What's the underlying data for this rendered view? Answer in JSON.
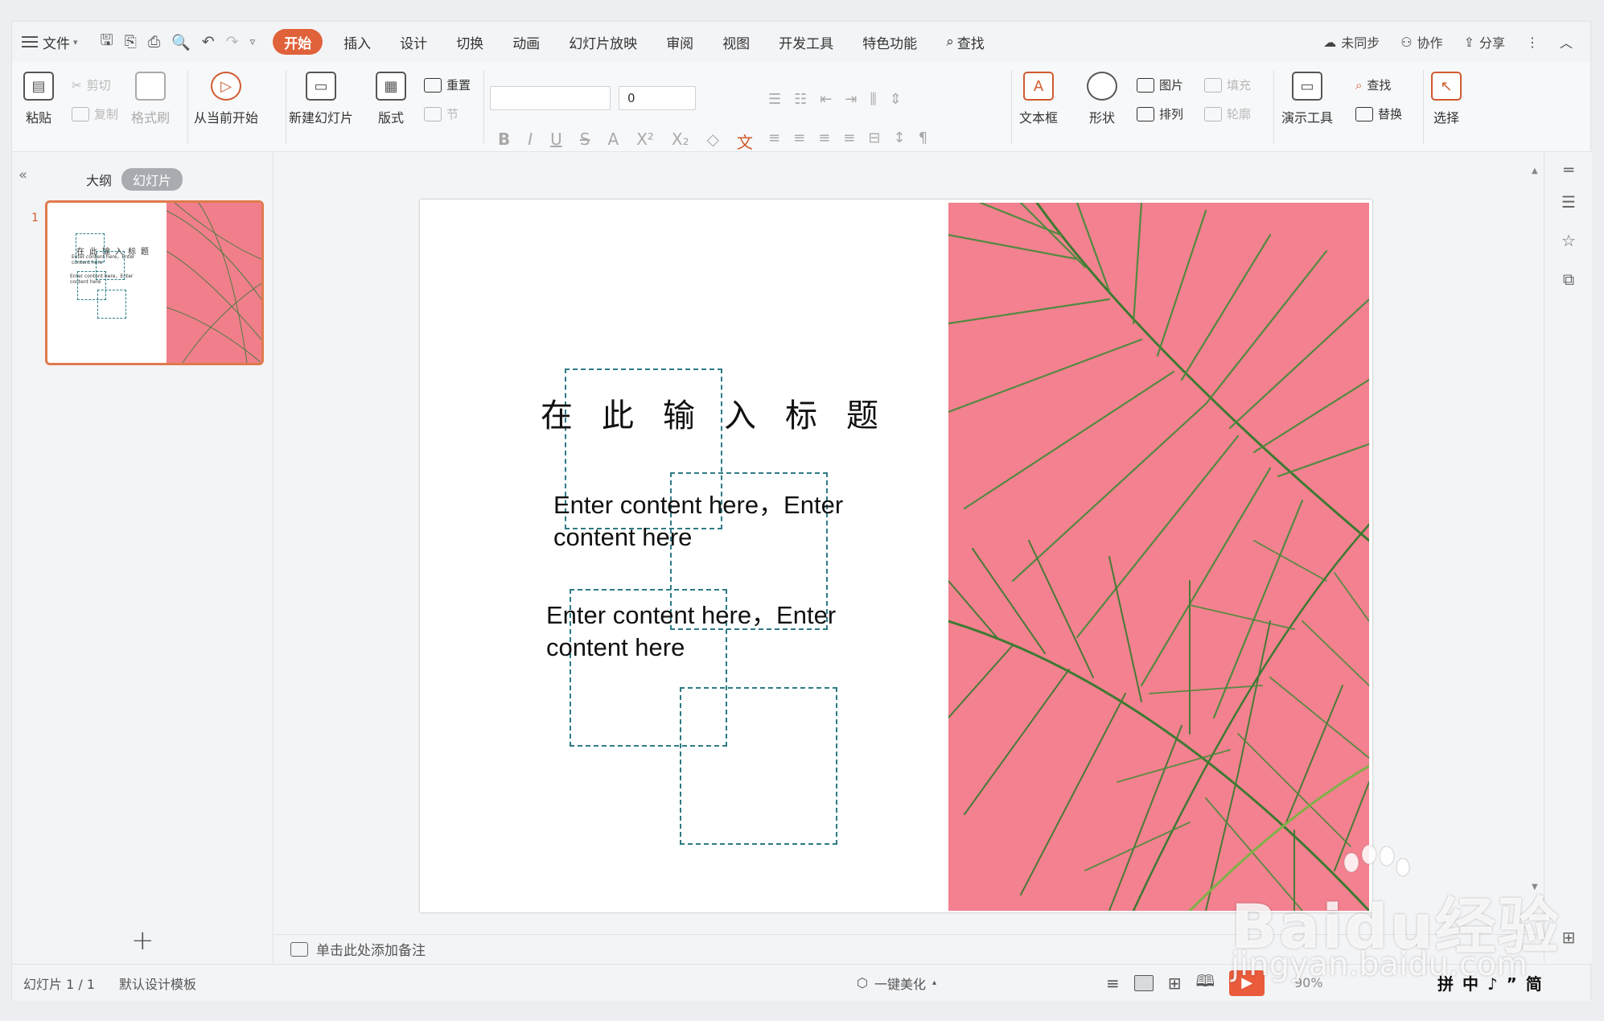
{
  "menubar": {
    "file": "文件",
    "tabs": [
      "开始",
      "插入",
      "设计",
      "切换",
      "动画",
      "幻灯片放映",
      "审阅",
      "视图",
      "开发工具",
      "特色功能"
    ],
    "search": "查找",
    "right": [
      "未同步",
      "协作",
      "分享"
    ]
  },
  "ribbon": {
    "paste": "粘贴",
    "cut": "剪切",
    "copy": "复制",
    "format_painter": "格式刷",
    "from_current": "从当前开始",
    "new_slide": "新建幻灯片",
    "layout": "版式",
    "reset": "重置",
    "section": "节",
    "font_size": "0",
    "textbox": "文本框",
    "shape": "形状",
    "picture": "图片",
    "fill": "填充",
    "arrange": "排列",
    "outline": "轮廓",
    "present_tools": "演示工具",
    "find": "查找",
    "replace": "替换",
    "select": "选择"
  },
  "left_panel": {
    "tab_outline": "大纲",
    "tab_slides": "幻灯片",
    "slide_number": "1"
  },
  "slide": {
    "title": "在此输入标题",
    "body1": "Enter content here，Enter content here",
    "body2": "Enter content here，Enter content here",
    "image_bg": "#f3818f",
    "box_color": "#2d7b83"
  },
  "notes": {
    "placeholder": "单击此处添加备注"
  },
  "status": {
    "slide_count": "幻灯片 1 / 1",
    "template": "默认设计模板",
    "beautify": "一键美化",
    "zoom": "90%",
    "ime": "拼 中 ♪ ” 简"
  },
  "watermark": {
    "line1": "Baidu经验",
    "line2": "jingyan.baidu.com"
  },
  "accent": "#e0623a"
}
